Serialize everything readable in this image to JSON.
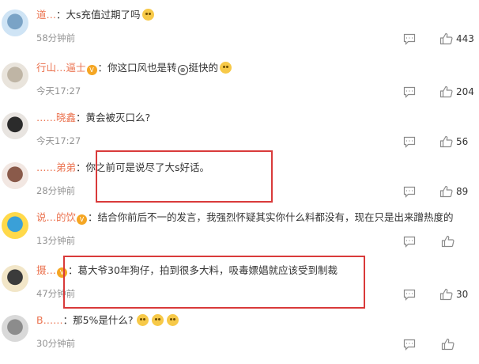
{
  "comments": [
    {
      "user": "道…",
      "text": "大s充值过期了吗",
      "time": "58分钟前",
      "likes": "443",
      "vip": false,
      "emoji": "doge",
      "extra_emoji": 0
    },
    {
      "user": "行山…逼士",
      "text": "你这口风也是转",
      "text2": "挺快的",
      "time": "今天17:27",
      "likes": "204",
      "vip": true,
      "emoji": "doge",
      "extra_emoji": 0
    },
    {
      "user": "……晓鑫",
      "text": "黄会被灭口么?",
      "time": "今天17:27",
      "likes": "56",
      "vip": false,
      "emoji": "",
      "extra_emoji": 0
    },
    {
      "user": "……弟弟",
      "text": "你之前可是说尽了大s好话。",
      "time": "28分钟前",
      "likes": "89",
      "vip": false,
      "emoji": "",
      "extra_emoji": 0
    },
    {
      "user": "说…的饮",
      "text": "结合你前后不一的发言，我强烈怀疑其实你什么料都没有，现在只是出来蹭热度的",
      "time": "13分钟前",
      "likes": "",
      "vip": true,
      "emoji": "",
      "extra_emoji": 0
    },
    {
      "user": "摄…",
      "text": "葛大爷30年狗仔，拍到很多大料，吸毒嫖娼就应该受到制裁",
      "time": "47分钟前",
      "likes": "30",
      "vip": true,
      "emoji": "",
      "extra_emoji": 0
    },
    {
      "user": "B……",
      "text": "那5%是什么?",
      "time": "30分钟前",
      "likes": "",
      "vip": false,
      "emoji": "",
      "extra_emoji": 3
    }
  ],
  "colors": {
    "highlight": "#d93a3a",
    "username": "#eb7350",
    "meta": "#939393"
  },
  "icons": {
    "reply": "comment-bubble-icon",
    "like": "thumbs-up-icon",
    "vip": "vip-badge-icon",
    "emoji": "laugh-emoji-icon"
  }
}
